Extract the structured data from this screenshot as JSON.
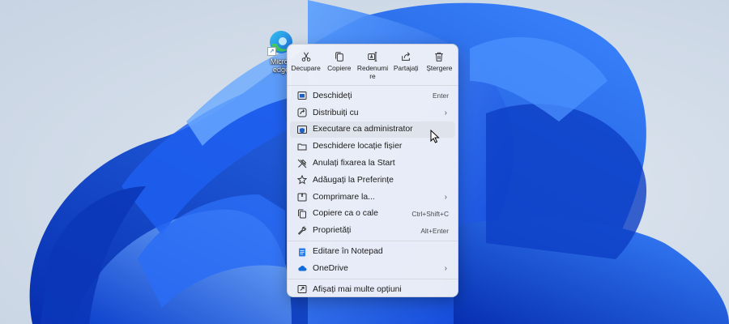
{
  "desktop": {
    "icon_name": "edge-icon",
    "shortcut_glyph": "↗",
    "label": "Micros\nedge"
  },
  "context_menu": {
    "actions": [
      {
        "label": "Decupare",
        "icon": "scissors-icon"
      },
      {
        "label": "Copiere",
        "icon": "copy-icon"
      },
      {
        "label": "Redenumire",
        "icon": "rename-icon"
      },
      {
        "label": "Partajați",
        "icon": "share-icon"
      },
      {
        "label": "Ștergere",
        "icon": "trash-icon"
      }
    ],
    "items": [
      {
        "label": "Deschideți",
        "shortcut": "Enter",
        "icon": "open-icon"
      },
      {
        "label": "Distribuiți cu",
        "submenu": "›",
        "icon": "share-with-icon"
      },
      {
        "label": "Executare ca administrator",
        "icon": "shield-icon"
      },
      {
        "label": "Deschidere locație fișier",
        "icon": "folder-icon"
      },
      {
        "label": "Anulați fixarea la Start",
        "icon": "unpin-icon"
      },
      {
        "label": "Adăugați la Preferințe",
        "icon": "star-icon"
      },
      {
        "label": "Comprimare la...",
        "submenu": "›",
        "icon": "zip-icon"
      },
      {
        "label": "Copiere ca o cale",
        "shortcut": "Ctrl+Shift+C",
        "icon": "copy-path-icon"
      },
      {
        "label": "Proprietăți",
        "shortcut": "Alt+Enter",
        "icon": "wrench-icon"
      },
      {
        "label": "Editare în Notepad",
        "icon": "notepad-icon"
      },
      {
        "label": "OneDrive",
        "submenu": "›",
        "icon": "cloud-icon"
      },
      {
        "label": "Afișați mai multe opțiuni",
        "icon": "more-options-icon"
      }
    ]
  },
  "colors": {
    "wallpaper_bg": "#cfd9e6",
    "bloom_dark": "#0a3fd8",
    "bloom_light": "#3b86ff",
    "menu_bg": "#eef1f8"
  }
}
